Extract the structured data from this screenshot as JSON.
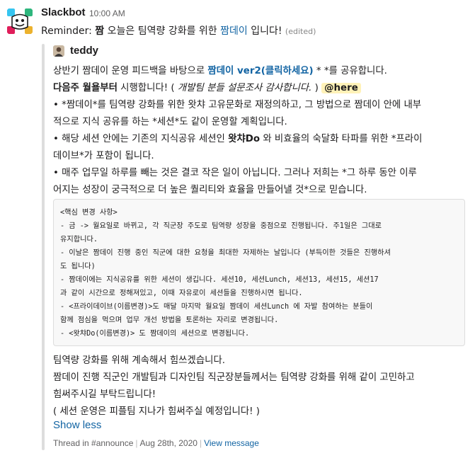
{
  "bot": {
    "name": "Slackbot",
    "time": "10:00 AM"
  },
  "reminder": {
    "label": "Reminder:",
    "prefix": "짬",
    "text": " 오늘은 팀역량 강화를 위한 ",
    "link": "짬데이",
    "suffix": " 입니다!",
    "edited": "(edited)"
  },
  "message": {
    "author": "teddy",
    "line1_a": "상반기 짬데이 운영 피드백을 바탕으로  ",
    "line1_link": "짬데이 ver2(클릭하세요)",
    "line1_b": " * *를 공유합니다.",
    "line2_bold": "다음주 월욜부터",
    "line2_a": " 시행합니다! ( ",
    "line2_italic": "개발팀 분들 설문조사 감사합니다.",
    "line2_b": " )  ",
    "line2_here": "@here",
    "b1_l1": "• *짬데이*를 팀역량 강화를 위한 왓챠 고유문화로 재정의하고, 그 방법으로 짬데이 안에 내부",
    "b1_l2": "적으로 지식 공유를 하는 *세션*도 같이 운영할 계획입니다.",
    "b2_l1a": "• 해당 세션 안에는 기존의 지식공유 세션인 ",
    "b2_l1_bold": "왓챠Do",
    "b2_l1b": " 와 비효율의 숙달화 타파를 위한 *프라이",
    "b2_l2": "데이브*가 포함이 됩니다.",
    "b3_l1": "• 매주 업무일 하루를 빼는 것은 결코 작은 일이 아닙니다. 그러나 저희는 *그 하루 동안 이루",
    "b3_l2": "어지는 성장이 궁극적으로 더 높은 퀄리티와 효율을 만들어낼 것*으로 믿습니다.",
    "code": [
      "<핵심 변경 사항>",
      "- 금 -> 월요일로 바뀌고, 각 직군장 주도로 팀역량 성장을 중점으로 진행됩니다. 주1일은 그대로",
      "유지합니다.",
      "- 이날은 짬데이 진행 중인 직군에 대한 요청을 최대한 자제하는 날입니다 (부득이한 것들은 진행하셔",
      "도 됩니다)",
      "- 짬데이에는 지식공유를 위한 세션이 생깁니다. 세션10, 세션Lunch, 세션13, 세션15, 세션17",
      "과 같이 시간으로 정해져있고, 이때 자유로이 세션들을 진행하시면 됩니다.",
      "-      <프라이데이브(이름변경)>도 매달 마지막 월요일 짬데이 세션Lunch 에 자발 참여하는 분들이",
      "함께 점심을 먹으며 업무 개선 방법을 토론하는 자리로 변경됩니다.",
      "-      <왓챠Do(이름변경)> 도 짬데이의 세션으로 변경됩니다."
    ],
    "after1": "팀역량 강화를 위해 계속해서 힘쓰겠습니다.",
    "after2": "짬데이 진행 직군인 개발팀과 디자인팀 직군장분들께서는 팀역량 강화를 위해 같이 고민하고",
    "after3": "힘써주시길 부탁드립니다!",
    "after4": "( 세션 운영은 피플팀 지나가 힘써주실 예정입니다! )",
    "show_less": "Show less"
  },
  "footer": {
    "thread": "Thread in #announce",
    "date": "Aug 28th, 2020",
    "view": "View message"
  }
}
